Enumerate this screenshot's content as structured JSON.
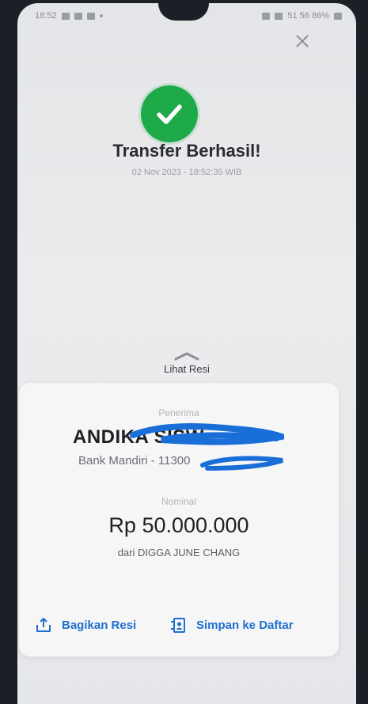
{
  "status_bar": {
    "time": "18:52",
    "right_text": "51 56 86%"
  },
  "header": {
    "close_icon": "close-icon",
    "success_icon": "check-circle-icon",
    "title": "Transfer Berhasil!",
    "timestamp": "02 Nov 2023 - 18:52:35 WIB"
  },
  "receipt_toggle": {
    "label": "Lihat Resi",
    "icon": "chevron-up-icon"
  },
  "receipt": {
    "recipient_label": "Penerima",
    "recipient_name": "ANDIKA SISW",
    "bank_line": "Bank Mandiri - 11300",
    "amount_label": "Nominal",
    "amount": "Rp 50.000.000",
    "sender_line": "dari DIGGA JUNE CHANG"
  },
  "actions": {
    "share_label": "Bagikan Resi",
    "share_icon": "share-icon",
    "save_label": "Simpan ke Daftar",
    "save_icon": "contact-add-icon"
  },
  "colors": {
    "success": "#1faa4a",
    "accent": "#1e6fd0",
    "redaction": "#1a6ed8"
  }
}
